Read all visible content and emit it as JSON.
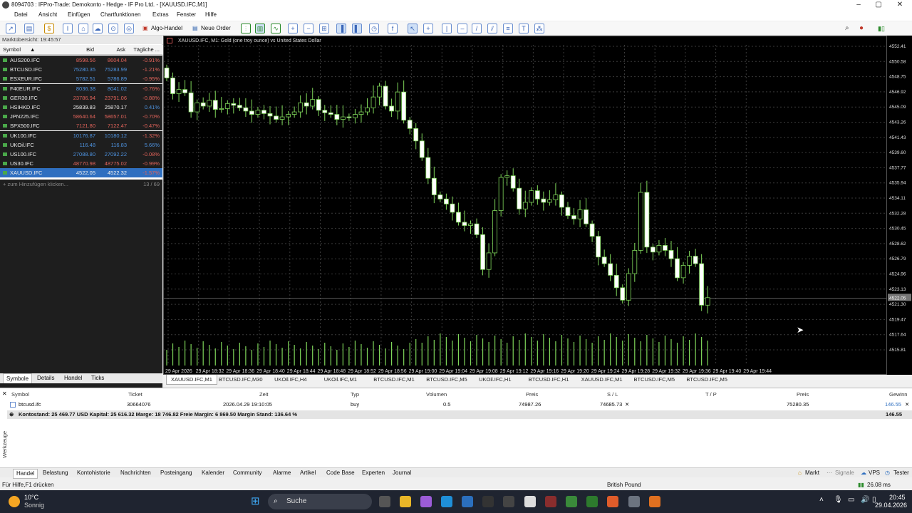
{
  "window": {
    "title": "8094703 : IFPro-Trade: Demokonto - Hedge - IF Pro Ltd. - [XAUUSD.IFC,M1]"
  },
  "menu": [
    "Datei",
    "Ansicht",
    "Einfügen",
    "Chartfunktionen",
    "Extras",
    "Fenster",
    "Hilfe"
  ],
  "toolbar": {
    "algo": "Algo-Handel",
    "new_order": "Neue Order"
  },
  "market_watch": {
    "header": "Marktübersicht: 19:45:57",
    "columns": {
      "symbol": "Symbol",
      "bid": "Bid",
      "ask": "Ask",
      "change": "Tägliche ..."
    },
    "rows": [
      {
        "symbol": "AUS200.IFC",
        "bid": "8598.56",
        "ask": "8604.04",
        "change": "-0.91%",
        "dir": "neg"
      },
      {
        "symbol": "BTCUSD.IFC",
        "bid": "75280.35",
        "ask": "75283.99",
        "change": "-1.21%",
        "dir": "pos"
      },
      {
        "symbol": "ESXEUR.IFC",
        "bid": "5782.51",
        "ask": "5786.89",
        "change": "-0.95%",
        "dir": "pos"
      },
      {
        "symbol": "F40EUR.IFC",
        "bid": "8036.38",
        "ask": "8041.02",
        "change": "-0.76%",
        "dir": "pos"
      },
      {
        "symbol": "GER30.IFC",
        "bid": "23786.94",
        "ask": "23791.06",
        "change": "-0.88%",
        "dir": "neg"
      },
      {
        "symbol": "HSIHKD.IFC",
        "bid": "25839.83",
        "ask": "25870.17",
        "change": "0.41%",
        "dir": "wht"
      },
      {
        "symbol": "JPN225.IFC",
        "bid": "58640.64",
        "ask": "58657.01",
        "change": "-0.70%",
        "dir": "neg"
      },
      {
        "symbol": "SPX500.IFC",
        "bid": "7121.80",
        "ask": "7122.47",
        "change": "-0.47%",
        "dir": "neg"
      },
      {
        "symbol": "UK100.IFC",
        "bid": "10176.87",
        "ask": "10180.12",
        "change": "-1.32%",
        "dir": "pos"
      },
      {
        "symbol": "UKOil.IFC",
        "bid": "116.48",
        "ask": "116.83",
        "change": "5.66%",
        "dir": "pos"
      },
      {
        "symbol": "US100.IFC",
        "bid": "27088.80",
        "ask": "27092.22",
        "change": "-0.08%",
        "dir": "pos"
      },
      {
        "symbol": "US30.IFC",
        "bid": "48770.98",
        "ask": "48775.02",
        "change": "-0.99%",
        "dir": "neg"
      },
      {
        "symbol": "XAUUSD.IFC",
        "bid": "4522.05",
        "ask": "4522.32",
        "change": "-1.57%",
        "dir": "sel"
      }
    ],
    "add_label": "+ zum Hinzufügen klicken...",
    "count": "13 / 69",
    "tabs": [
      "Symbole",
      "Details",
      "Handel",
      "Ticks"
    ]
  },
  "chart": {
    "label": "XAUUSD.IFC, M1:  Gold (one troy ounce) vs United States Dollar",
    "price_ticks": [
      "4552.41",
      "4550.58",
      "4548.75",
      "4546.92",
      "4545.09",
      "4543.26",
      "4541.43",
      "4539.60",
      "4537.77",
      "4535.94",
      "4534.11",
      "4532.28",
      "4530.45",
      "4528.62",
      "4526.79",
      "4524.96",
      "4523.13",
      "4521.30",
      "4519.47",
      "4517.64",
      "4515.81"
    ],
    "current_price": "4522.05",
    "time_ticks": [
      "29 Apr 2026",
      "29 Apr 18:32",
      "29 Apr 18:36",
      "29 Apr 18:40",
      "29 Apr 18:44",
      "29 Apr 18:48",
      "29 Apr 18:52",
      "29 Apr 18:56",
      "29 Apr 19:00",
      "29 Apr 19:04",
      "29 Apr 19:08",
      "29 Apr 19:12",
      "29 Apr 19:16",
      "29 Apr 19:20",
      "29 Apr 19:24",
      "29 Apr 19:28",
      "29 Apr 19:32",
      "29 Apr 19:36",
      "29 Apr 19:40",
      "29 Apr 19:44"
    ],
    "tabs": [
      "XAUUSD.IFC,M1",
      "BTCUSD.IFC,M30",
      "UKOil.IFC,H4",
      "UKOil.IFC,M1",
      "BTCUSD.IFC,M1",
      "BTCUSD.IFC,M5",
      "UKOil.IFC,H1",
      "BTCUSD.IFC,H1",
      "XAUUSD.IFC,M1",
      "BTCUSD.IFC,M5",
      "BTCUSD.IFC,M5"
    ]
  },
  "terminal": {
    "columns": [
      "Symbol",
      "Ticket",
      "Zeit",
      "Typ",
      "Volumen",
      "Preis",
      "S / L",
      "T / P",
      "Preis",
      "Gewinn"
    ],
    "row": {
      "symbol": "btcusd.ifc",
      "ticket": "30664076",
      "time": "2026.04.29 19:10:05",
      "type": "buy",
      "volume": "0.5",
      "price": "74987.26",
      "sl": "74685.73",
      "tp": "",
      "cur": "75280.35",
      "profit": "146.55"
    },
    "balance": "Kontostand: 25 469.77 USD  Kapital: 25 616.32  Marge: 18 746.82  Freie Margin: 6 869.50  Margin Stand: 136.64 %",
    "balance_profit": "146.55",
    "side_label": "Werkzeuge",
    "tabs": [
      "Handel",
      "Belastung",
      "Kontohistorie",
      "Nachrichten",
      "Posteingang",
      "Kalender",
      "Community",
      "Alarme",
      "Artikel",
      "Code Base",
      "Experten",
      "Journal"
    ],
    "right_tabs": [
      "Markt",
      "Signale",
      "VPS",
      "Tester"
    ]
  },
  "status": {
    "help": "Für Hilfe,F1 drücken",
    "profile": "British Pound",
    "ping": "26.08 ms"
  },
  "taskbar": {
    "weather_temp": "10°C",
    "weather_desc": "Sonnig",
    "search": "Suche",
    "time": "20:45",
    "date": "29.04.2026"
  }
}
